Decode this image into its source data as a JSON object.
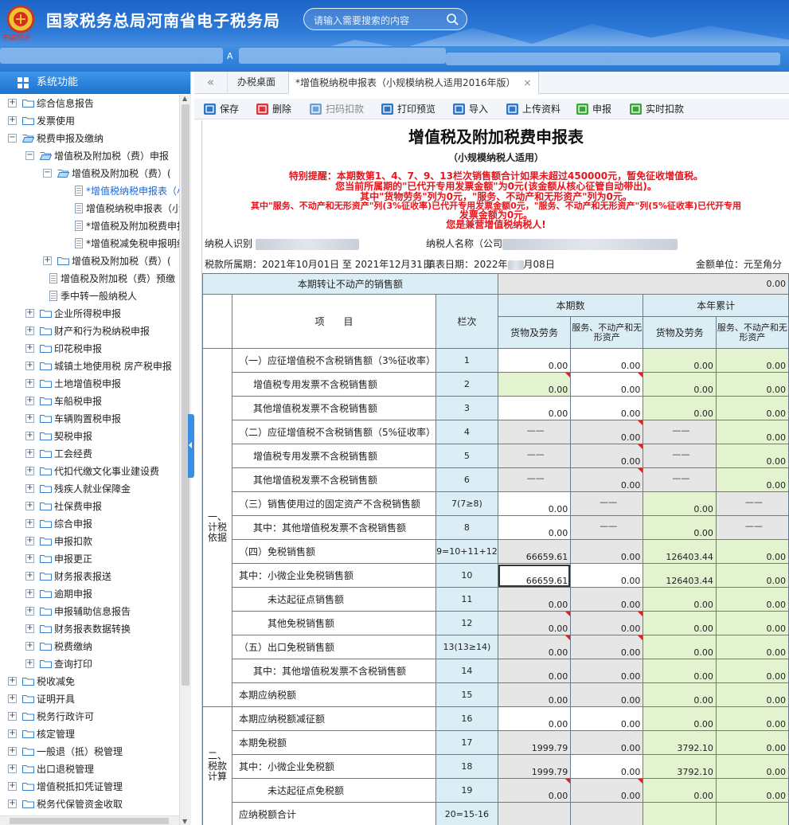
{
  "header": {
    "title": "国家税务总局河南省电子税务局",
    "logo_text": "中国税务",
    "search_placeholder": "请输入需要搜索的内容",
    "mark": "A"
  },
  "sidebar": {
    "title": "系统功能",
    "items": [
      {
        "label": "综合信息报告",
        "lvl": 0,
        "icon": "folder",
        "exp": "+"
      },
      {
        "label": "发票使用",
        "lvl": 0,
        "icon": "folder",
        "exp": "+"
      },
      {
        "label": "税费申报及缴纳",
        "lvl": 0,
        "icon": "folder-open",
        "exp": "−"
      },
      {
        "label": "增值税及附加税（费）申报",
        "lvl": 1,
        "icon": "folder-open",
        "exp": "−"
      },
      {
        "label": "增值税及附加税（费）(",
        "lvl": 2,
        "icon": "folder-open",
        "exp": "−"
      },
      {
        "label": "*增值税纳税申报表（小",
        "lvl": 3,
        "icon": "page",
        "sel": true
      },
      {
        "label": "增值税纳税申报表（小规",
        "lvl": 3,
        "icon": "page"
      },
      {
        "label": "*增值税及附加税费申报",
        "lvl": 3,
        "icon": "page"
      },
      {
        "label": "*增值税减免税申报明细",
        "lvl": 3,
        "icon": "page"
      },
      {
        "label": "增值税及附加税（费）(",
        "lvl": 2,
        "icon": "folder",
        "exp": "+"
      },
      {
        "label": "增值税及附加税（费）预缴",
        "lvl": 2,
        "icon": "page",
        "shift": true
      },
      {
        "label": "季中转一般纳税人",
        "lvl": 2,
        "icon": "page",
        "shift": true
      },
      {
        "label": "企业所得税申报",
        "lvl": 1,
        "icon": "folder",
        "exp": "+"
      },
      {
        "label": "财产和行为税纳税申报",
        "lvl": 1,
        "icon": "folder",
        "exp": "+"
      },
      {
        "label": "印花税申报",
        "lvl": 1,
        "icon": "folder",
        "exp": "+"
      },
      {
        "label": "城镇土地使用税 房产税申报",
        "lvl": 1,
        "icon": "folder",
        "exp": "+"
      },
      {
        "label": "土地增值税申报",
        "lvl": 1,
        "icon": "folder",
        "exp": "+"
      },
      {
        "label": "车船税申报",
        "lvl": 1,
        "icon": "folder",
        "exp": "+"
      },
      {
        "label": "车辆购置税申报",
        "lvl": 1,
        "icon": "folder",
        "exp": "+"
      },
      {
        "label": "契税申报",
        "lvl": 1,
        "icon": "folder",
        "exp": "+"
      },
      {
        "label": "工会经费",
        "lvl": 1,
        "icon": "folder",
        "exp": "+"
      },
      {
        "label": "代扣代缴文化事业建设费",
        "lvl": 1,
        "icon": "folder",
        "exp": "+"
      },
      {
        "label": "残疾人就业保障金",
        "lvl": 1,
        "icon": "folder",
        "exp": "+"
      },
      {
        "label": "社保费申报",
        "lvl": 1,
        "icon": "folder",
        "exp": "+"
      },
      {
        "label": "综合申报",
        "lvl": 1,
        "icon": "folder",
        "exp": "+"
      },
      {
        "label": "申报扣款",
        "lvl": 1,
        "icon": "folder",
        "exp": "+"
      },
      {
        "label": "申报更正",
        "lvl": 1,
        "icon": "folder",
        "exp": "+"
      },
      {
        "label": "财务报表报送",
        "lvl": 1,
        "icon": "folder",
        "exp": "+"
      },
      {
        "label": "逾期申报",
        "lvl": 1,
        "icon": "folder",
        "exp": "+"
      },
      {
        "label": "申报辅助信息报告",
        "lvl": 1,
        "icon": "folder",
        "exp": "+"
      },
      {
        "label": "财务报表数据转换",
        "lvl": 1,
        "icon": "folder",
        "exp": "+"
      },
      {
        "label": "税费缴纳",
        "lvl": 1,
        "icon": "folder",
        "exp": "+"
      },
      {
        "label": "查询打印",
        "lvl": 1,
        "icon": "folder",
        "exp": "+"
      },
      {
        "label": "税收减免",
        "lvl": 0,
        "icon": "folder",
        "exp": "+"
      },
      {
        "label": "证明开具",
        "lvl": 0,
        "icon": "folder",
        "exp": "+"
      },
      {
        "label": "税务行政许可",
        "lvl": 0,
        "icon": "folder",
        "exp": "+"
      },
      {
        "label": "核定管理",
        "lvl": 0,
        "icon": "folder",
        "exp": "+"
      },
      {
        "label": "一般退（抵）税管理",
        "lvl": 0,
        "icon": "folder",
        "exp": "+"
      },
      {
        "label": "出口退税管理",
        "lvl": 0,
        "icon": "folder",
        "exp": "+"
      },
      {
        "label": "增值税抵扣凭证管理",
        "lvl": 0,
        "icon": "folder",
        "exp": "+"
      },
      {
        "label": "税务代保管资金收取",
        "lvl": 0,
        "icon": "folder",
        "exp": "+"
      }
    ]
  },
  "tabs": {
    "back": "«",
    "home": "办税桌面",
    "current": "*增值税纳税申报表（小规模纳税人适用2016年版）",
    "close": "×"
  },
  "toolbar": [
    {
      "label": "保存",
      "color": "#2f76c9",
      "icon": "save-icon",
      "disabled": false
    },
    {
      "label": "删除",
      "color": "#d9363e",
      "icon": "delete-icon",
      "disabled": false
    },
    {
      "label": "扫码扣款",
      "color": "#6f9fd8",
      "icon": "scan-icon",
      "disabled": true
    },
    {
      "label": "打印预览",
      "color": "#2f76c9",
      "icon": "print-icon",
      "disabled": false
    },
    {
      "label": "导入",
      "color": "#2f76c9",
      "icon": "import-icon",
      "disabled": false
    },
    {
      "label": "上传资料",
      "color": "#2f76c9",
      "icon": "upload-icon",
      "disabled": false
    },
    {
      "label": "申报",
      "color": "#3aa63a",
      "icon": "submit-icon",
      "disabled": false
    },
    {
      "label": "实时扣款",
      "color": "#3aa63a",
      "icon": "deduct-icon",
      "disabled": false
    }
  ],
  "form": {
    "title": "增值税及附加税费申报表",
    "subtitle": "（小规模纳税人适用）",
    "warnings": [
      "特别提醒：本期数第1、4、7、9、13栏次销售额合计如果未超过450000元，暂免征收增值税。",
      "您当前所属期的\"已代开专用发票金额\"为0元(该金额从核心征管自动带出)。",
      "其中\"货物劳务\"列为0元，\"服务、不动产和无形资产\"列为0元。",
      "其中\"服务、不动产和无形资产\"列(3%征收率)已代开专用发票金额0元，\"服务、不动产和无形资产\"列(5%征收率)已代开专用",
      "发票金额为0元。",
      "您是兼营增值税纳税人!"
    ],
    "taxpayer_id_label": "纳税人识别",
    "taxpayer_name_label": "纳税人名称（公司",
    "period": "税款所属期：2021年10月01日 至 2021年12月31日",
    "fill_date": "填表日期：2022年",
    "fill_date_tail": "月08日",
    "unit": "金额单位：元至角分"
  },
  "table": {
    "transfer_label": "本期转让不动产的销售额",
    "transfer_value": "0.00",
    "h_item": "项　　目",
    "h_line": "栏次",
    "h_current": "本期数",
    "h_ytd": "本年累计",
    "h_goods": "货物及劳务",
    "h_services": "服务、不动产和无形资产",
    "sec1": "一、计税依据",
    "sec2": "二、税款计算",
    "rows": [
      {
        "label": "（一）应征增值税不含税销售额（3%征收率）",
        "line": "1",
        "ind": 0,
        "c": [
          [
            "wt",
            "0.00",
            0
          ],
          [
            "wt",
            "0.00",
            0
          ],
          [
            "gn",
            "0.00",
            0
          ],
          [
            "gn",
            "0.00",
            0
          ]
        ]
      },
      {
        "label": "增值税专用发票不含税销售额",
        "line": "2",
        "ind": 1,
        "c": [
          [
            "gn",
            "0.00",
            1
          ],
          [
            "wt",
            "0.00",
            1
          ],
          [
            "gn",
            "0.00",
            0
          ],
          [
            "gn",
            "0.00",
            0
          ]
        ]
      },
      {
        "label": "其他增值税发票不含税销售额",
        "line": "3",
        "ind": 1,
        "c": [
          [
            "wt",
            "0.00",
            0
          ],
          [
            "wt",
            "0.00",
            0
          ],
          [
            "gn",
            "0.00",
            0
          ],
          [
            "gn",
            "0.00",
            0
          ]
        ]
      },
      {
        "label": "（二）应征增值税不含税销售额（5%征收率）",
        "line": "4",
        "ind": 0,
        "c": [
          [
            "gr",
            "——",
            0
          ],
          [
            "gr",
            "0.00",
            1
          ],
          [
            "gr",
            "——",
            0
          ],
          [
            "gn",
            "0.00",
            0
          ]
        ]
      },
      {
        "label": "增值税专用发票不含税销售额",
        "line": "5",
        "ind": 1,
        "c": [
          [
            "gr",
            "——",
            0
          ],
          [
            "gr",
            "0.00",
            1
          ],
          [
            "gr",
            "——",
            0
          ],
          [
            "gn",
            "0.00",
            0
          ]
        ]
      },
      {
        "label": "其他增值税发票不含税销售额",
        "line": "6",
        "ind": 1,
        "c": [
          [
            "gr",
            "——",
            0
          ],
          [
            "gr",
            "0.00",
            1
          ],
          [
            "gr",
            "——",
            0
          ],
          [
            "gn",
            "0.00",
            0
          ]
        ]
      },
      {
        "label": "（三）销售使用过的固定资产不含税销售额",
        "line": "7(7≥8)",
        "ind": 0,
        "c": [
          [
            "wt",
            "0.00",
            0
          ],
          [
            "gr",
            "——",
            0
          ],
          [
            "gn",
            "0.00",
            0
          ],
          [
            "gr",
            "——",
            0
          ]
        ]
      },
      {
        "label": "其中：其他增值税发票不含税销售额",
        "line": "8",
        "ind": 1,
        "c": [
          [
            "wt",
            "0.00",
            0
          ],
          [
            "gr",
            "——",
            0
          ],
          [
            "gn",
            "0.00",
            0
          ],
          [
            "gr",
            "——",
            0
          ]
        ]
      },
      {
        "label": "（四）免税销售额",
        "line": "9=10+11+12",
        "ind": 0,
        "c": [
          [
            "gr",
            "66659.61",
            0
          ],
          [
            "gr",
            "0.00",
            0
          ],
          [
            "gn",
            "126403.44",
            0
          ],
          [
            "gn",
            "0.00",
            0
          ]
        ]
      },
      {
        "label": "其中：小微企业免税销售额",
        "line": "10",
        "ind": 0,
        "c": [
          [
            "wt",
            "66659.61",
            0
          ],
          [
            "wt",
            "0.00",
            0
          ],
          [
            "gn",
            "126403.44",
            0
          ],
          [
            "gn",
            "0.00",
            0
          ]
        ],
        "focus": true
      },
      {
        "label": "未达起征点销售额",
        "line": "11",
        "ind": 2,
        "c": [
          [
            "gr",
            "0.00",
            0
          ],
          [
            "gr",
            "0.00",
            0
          ],
          [
            "gn",
            "0.00",
            0
          ],
          [
            "gn",
            "0.00",
            0
          ]
        ]
      },
      {
        "label": "其他免税销售额",
        "line": "12",
        "ind": 2,
        "c": [
          [
            "gr",
            "0.00",
            1
          ],
          [
            "gr",
            "0.00",
            1
          ],
          [
            "gn",
            "0.00",
            0
          ],
          [
            "gn",
            "0.00",
            0
          ]
        ]
      },
      {
        "label": "（五）出口免税销售额",
        "line": "13(13≥14)",
        "ind": 0,
        "c": [
          [
            "gr",
            "0.00",
            1
          ],
          [
            "gr",
            "0.00",
            1
          ],
          [
            "gn",
            "0.00",
            0
          ],
          [
            "gn",
            "0.00",
            0
          ]
        ]
      },
      {
        "label": "其中：其他增值税发票不含税销售额",
        "line": "14",
        "ind": 1,
        "c": [
          [
            "gr",
            "0.00",
            0
          ],
          [
            "gr",
            "0.00",
            0
          ],
          [
            "gn",
            "0.00",
            0
          ],
          [
            "gn",
            "0.00",
            0
          ]
        ]
      },
      {
        "label": "本期应纳税额",
        "line": "15",
        "ind": 0,
        "c": [
          [
            "gr",
            "0.00",
            0
          ],
          [
            "gr",
            "0.00",
            0
          ],
          [
            "gn",
            "0.00",
            0
          ],
          [
            "gn",
            "0.00",
            0
          ]
        ]
      },
      {
        "label": "本期应纳税额减征额",
        "line": "16",
        "ind": 0,
        "c": [
          [
            "wt",
            "0.00",
            0
          ],
          [
            "wt",
            "0.00",
            0
          ],
          [
            "gn",
            "0.00",
            0
          ],
          [
            "gn",
            "0.00",
            0
          ]
        ]
      },
      {
        "label": "本期免税额",
        "line": "17",
        "ind": 0,
        "c": [
          [
            "gr",
            "1999.79",
            0
          ],
          [
            "gr",
            "0.00",
            0
          ],
          [
            "gn",
            "3792.10",
            0
          ],
          [
            "gn",
            "0.00",
            0
          ]
        ]
      },
      {
        "label": "其中：小微企业免税额",
        "line": "18",
        "ind": 0,
        "c": [
          [
            "gr",
            "1999.79",
            0
          ],
          [
            "wt",
            "0.00",
            0
          ],
          [
            "gn",
            "3792.10",
            0
          ],
          [
            "gn",
            "0.00",
            0
          ]
        ]
      },
      {
        "label": "未达起征点免税额",
        "line": "19",
        "ind": 2,
        "c": [
          [
            "gr",
            "0.00",
            1
          ],
          [
            "gr",
            "0.00",
            1
          ],
          [
            "gn",
            "0.00",
            0
          ],
          [
            "gn",
            "0.00",
            0
          ]
        ]
      },
      {
        "label": "应纳税额合计",
        "line": "20=15-16",
        "ind": 0,
        "c": [
          [
            "gr",
            "",
            0
          ],
          [
            "gr",
            "",
            0
          ],
          [
            "gn",
            "",
            0
          ],
          [
            "gn",
            "",
            0
          ]
        ]
      }
    ]
  }
}
